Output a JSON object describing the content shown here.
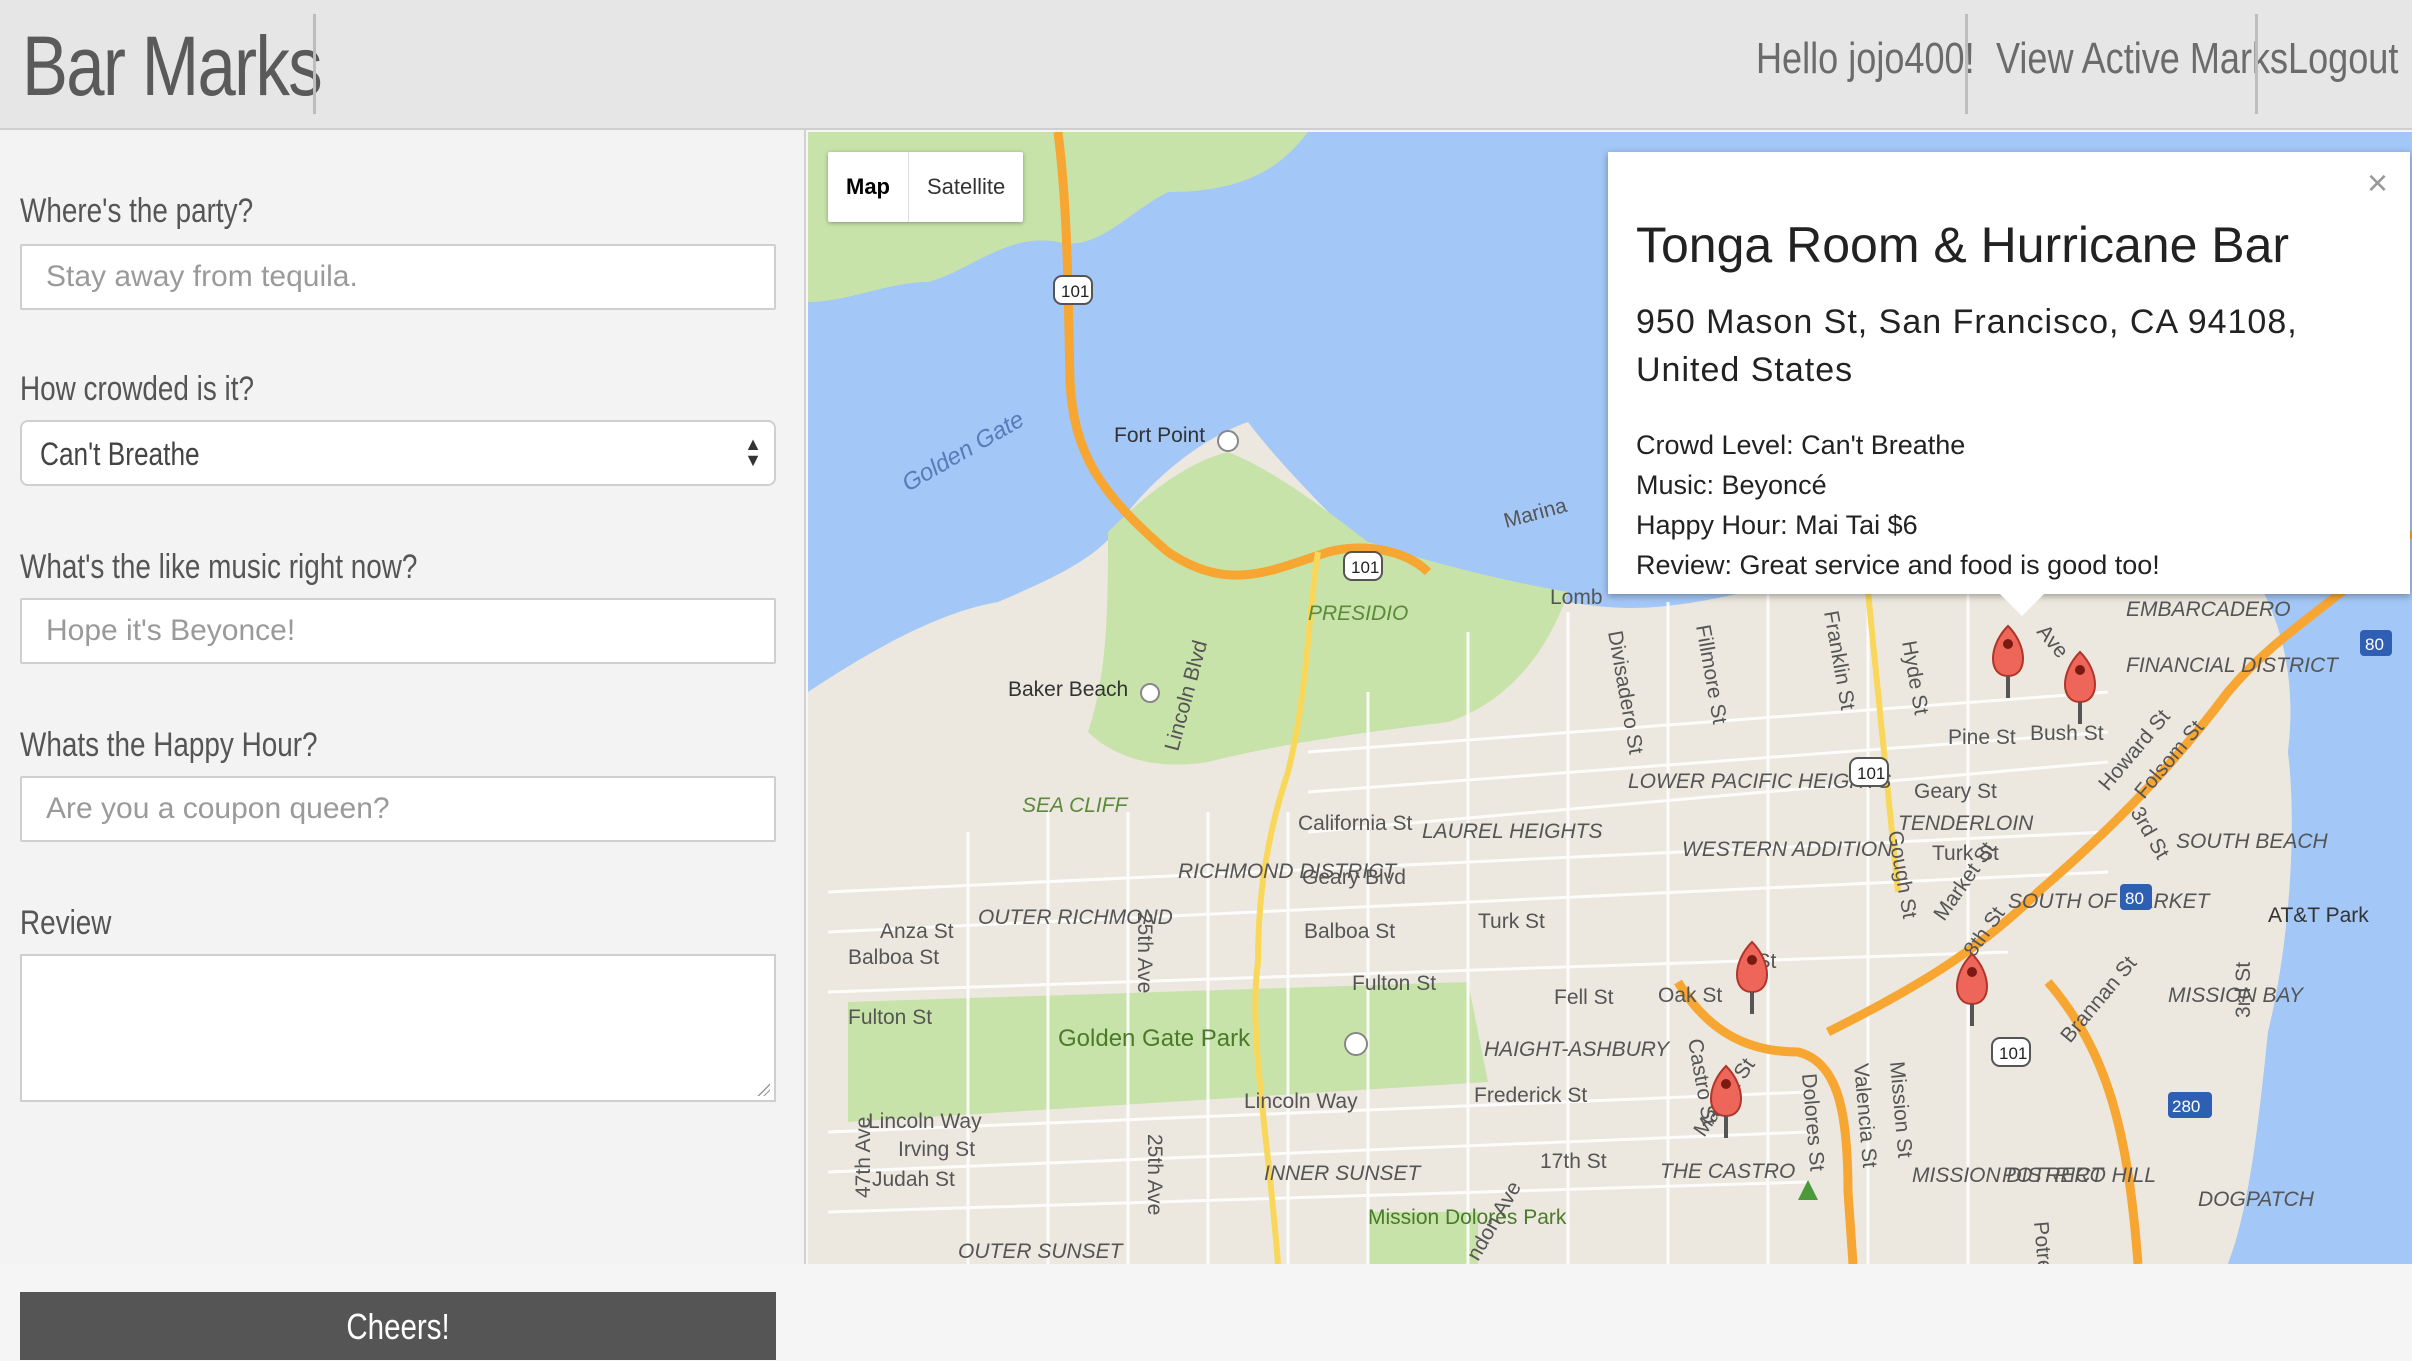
{
  "navbar": {
    "brand": "Bar Marks",
    "greeting": "Hello jojo400!",
    "view_marks": "View Active Marks",
    "logout": "Logout"
  },
  "form": {
    "party_label": "Where's the party?",
    "party_placeholder": "Stay away from tequila.",
    "crowd_label": "How crowded is it?",
    "crowd_value": "Can't Breathe",
    "music_label": "What's the like music right now?",
    "music_placeholder": "Hope it's Beyonce!",
    "happy_label": "Whats the Happy Hour?",
    "happy_placeholder": "Are you a coupon queen?",
    "review_label": "Review",
    "submit": "Cheers!"
  },
  "map": {
    "type_map": "Map",
    "type_satellite": "Satellite",
    "labels": {
      "golden_gate": "Golden Gate",
      "fort_point": "Fort Point",
      "presidio": "PRESIDIO",
      "baker_beach": "Baker Beach",
      "lincoln_blvd": "Lincoln Blvd",
      "sea_cliff": "SEA CLIFF",
      "california_st": "California St",
      "laurel_heights": "LAUREL HEIGHTS",
      "richmond_district": "RICHMOND DISTRICT",
      "geary_blvd": "Geary Blvd",
      "outer_richmond": "OUTER RICHMOND",
      "anza_st": "Anza St",
      "balboa_st_w": "Balboa St",
      "balboa_st": "Balboa St",
      "twentyfifth_ave": "25th Ave",
      "turk_st": "Turk St",
      "fulton_st_w": "Fulton St",
      "fulton_st": "Fulton St",
      "golden_gate_park": "Golden Gate Park",
      "fell_st": "Fell St",
      "oak_st": "Oak St",
      "haight_ashbury": "HAIGHT-ASHBURY",
      "frederick_st": "Frederick St",
      "lincoln_way": "Lincoln Way",
      "lincoln_way_w": "Lincoln Way",
      "irving_st": "Irving St",
      "judah_st": "Judah St",
      "forty7th_ave": "47th Ave",
      "twentyfifth_ave_s": "25th Ave",
      "inner_sunset": "INNER SUNSET",
      "outer_sunset": "OUTER SUNSET",
      "seventeenth_st": "17th St",
      "the_castro": "THE CASTRO",
      "mission_dolores_park": "Mission Dolores Park",
      "mission_district": "MISSION DISTRICT",
      "potrero_hill": "POTRERO HILL",
      "dogpatch": "DOGPATCH",
      "mission_bay": "MISSION BAY",
      "att_park": "AT&T Park",
      "south_beach": "SOUTH BEACH",
      "south_of_market": "SOUTH OF MARKET",
      "tenderloin": "TENDERLOIN",
      "western_addition": "WESTERN ADDITION",
      "lower_pacific_heights": "LOWER PACIFIC HEIGHTS",
      "embarcadero": "EMBARCADERO",
      "financial_district": "FINANCIAL DISTRICT",
      "marina": "Marina",
      "divisadero_st": "Divisadero St",
      "fillmore_st": "Fillmore St",
      "franklin_st": "Franklin St",
      "hyde_st": "Hyde St",
      "pine_st": "Pine St",
      "bush_st": "Bush St",
      "geary_st": "Geary St",
      "turk_st_e": "Turk St",
      "market_st": "Market St",
      "eighth_st": "8th St",
      "howard_st": "Howard St",
      "folsom_st": "Folsom St",
      "third_st": "3rd St",
      "brannan_st": "Brannan St",
      "gough_st": "Gough St",
      "castro_st": "Castro St",
      "dolores_st": "Dolores St",
      "valencia_st": "Valencia St",
      "mission_st": "Mission St",
      "third_st_s": "3rd St",
      "market_st_s": "Market St",
      "potrero": "Potre",
      "page_st_tail": "l St",
      "lomb": "Lomb",
      "mason_tail": "Ave",
      "hwy101": "101",
      "hwy80": "80",
      "hwy280": "280",
      "dolores_ave": "ndon Ave"
    }
  },
  "infowindow": {
    "title": "Tonga Room & Hurricane Bar",
    "address": "950 Mason St, San Francisco, CA 94108, United States",
    "crowd": "Crowd Level: Can't Breathe",
    "music": "Music: Beyoncé",
    "happy_hour": "Happy Hour: Mai Tai $6",
    "review": "Review: Great service and food is good too!",
    "close": "×"
  },
  "colors": {
    "water": "#a3c7f7",
    "land": "#ece8df",
    "park": "#c8e3a9",
    "highway": "#f6a631",
    "marker": "#ee6659"
  }
}
